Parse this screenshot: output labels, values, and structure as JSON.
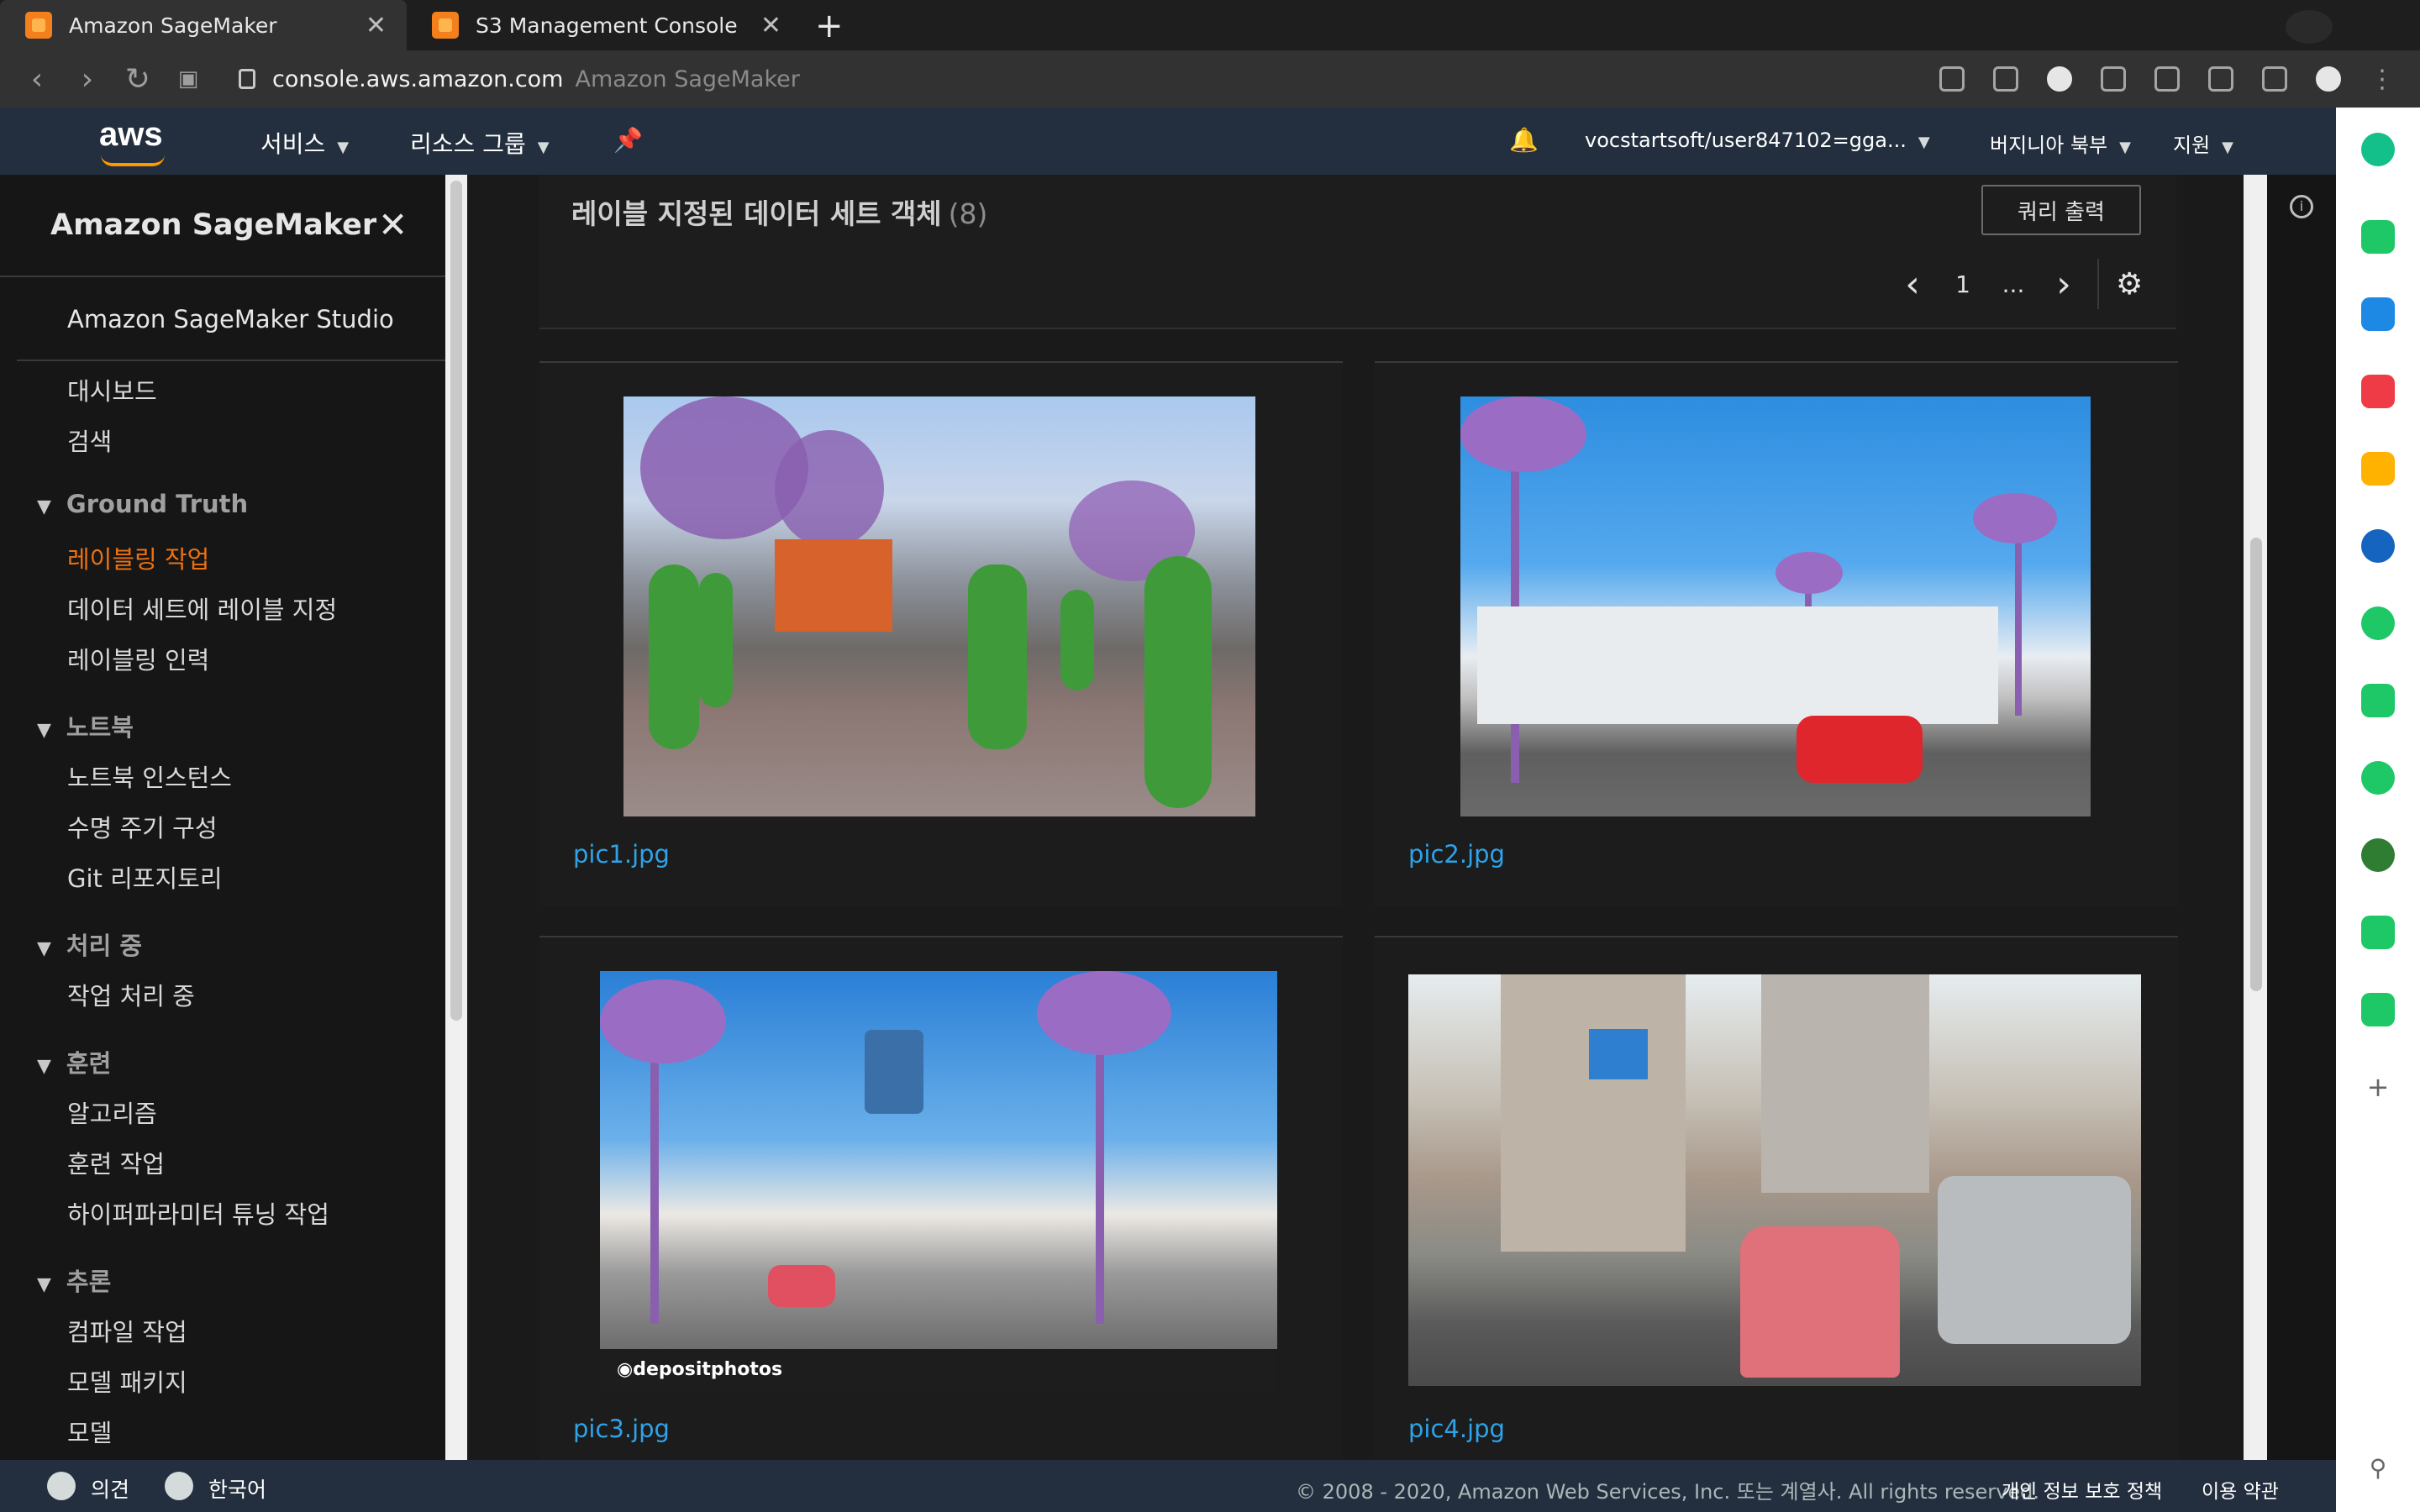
{
  "browser": {
    "tabs": [
      {
        "title": "Amazon SageMaker",
        "active": true
      },
      {
        "title": "S3 Management Console",
        "active": false
      }
    ],
    "new_tab_icon": "+",
    "url_host": "console.aws.amazon.com",
    "url_title": "Amazon SageMaker"
  },
  "aws_nav": {
    "logo": "aws",
    "services": "서비스",
    "resource_groups": "리소스 그룹",
    "account": "vocstartsoft/user847102=gga...",
    "region": "버지니아 북부",
    "support": "지원"
  },
  "sidebar": {
    "title": "Amazon SageMaker",
    "studio": "Amazon SageMaker Studio",
    "items_top": [
      "대시보드",
      "검색"
    ],
    "sections": [
      {
        "title": "Ground Truth",
        "items": [
          "레이블링 작업",
          "데이터 세트에 레이블 지정",
          "레이블링 인력"
        ],
        "active_item": 0
      },
      {
        "title": "노트북",
        "items": [
          "노트북 인스턴스",
          "수명 주기 구성",
          "Git 리포지토리"
        ]
      },
      {
        "title": "처리 중",
        "items": [
          "작업 처리 중"
        ]
      },
      {
        "title": "훈련",
        "items": [
          "알고리즘",
          "훈련 작업",
          "하이퍼파라미터 튜닝 작업"
        ]
      },
      {
        "title": "추론",
        "items": [
          "컴파일 작업",
          "모델 패키지",
          "모델"
        ]
      }
    ]
  },
  "main": {
    "title": "레이블 지정된 데이터 세트 객체",
    "count": "(8)",
    "query_button": "쿼리 출력",
    "pager": {
      "prev": "‹",
      "page": "1",
      "ellipsis": "...",
      "next": "›"
    },
    "cards": [
      {
        "filename": "pic1.jpg"
      },
      {
        "filename": "pic2.jpg"
      },
      {
        "filename": "pic3.jpg"
      },
      {
        "filename": "pic4.jpg"
      }
    ]
  },
  "footer": {
    "feedback": "의견",
    "language": "한국어",
    "copyright": "© 2008 - 2020, Amazon Web Services, Inc. 또는 계열사. All rights reserved.",
    "privacy": "개인 정보 보호 정책",
    "terms": "이용 약관"
  },
  "colors": {
    "aws_nav": "#232f3e",
    "accent_orange": "#ec7211",
    "link_blue": "#2ea3e8"
  }
}
